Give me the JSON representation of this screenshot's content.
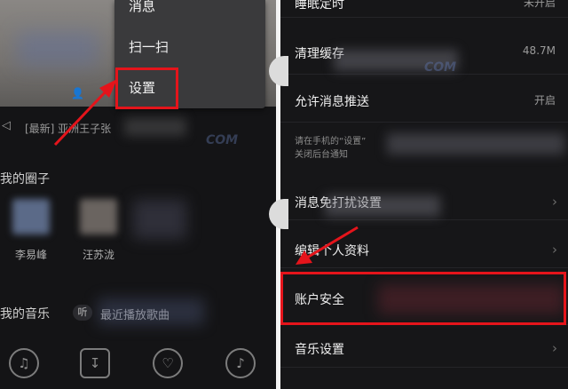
{
  "left": {
    "popup_menu": {
      "messages": "消息",
      "scan": "扫一扫",
      "settings": "设置"
    },
    "notice": {
      "text": "[最新] 亚洲王子张"
    },
    "watermark": "COM",
    "my_circle": {
      "title": "我的圈子",
      "friends": [
        {
          "name": "李易峰"
        },
        {
          "name": "汪苏泷"
        }
      ]
    },
    "my_music": {
      "title": "我的音乐",
      "badge": "听",
      "text": "最近播放歌曲"
    },
    "bottom_icons": [
      "music-note-person-icon",
      "download-icon",
      "heart-icon",
      "music-file-icon"
    ]
  },
  "right": {
    "rows": {
      "sleep_timer": {
        "label": "睡眠定时",
        "value": "未开启"
      },
      "clear_cache": {
        "label": "清理缓存",
        "value": "48.7M"
      },
      "push": {
        "label": "允许消息推送",
        "value": "开启"
      },
      "push_desc_line1": "请在手机的“设置”",
      "push_desc_line2": "关闭后台通知",
      "dnd": {
        "label": "消息免打扰设置"
      },
      "profile": {
        "label": "编辑个人资料"
      },
      "account": {
        "label": "账户安全"
      },
      "music_settings": {
        "label": "音乐设置"
      }
    },
    "watermark": "COM"
  },
  "colors": {
    "highlight": "#e5141b",
    "background": "#141416",
    "popup": "#3a3a3c"
  }
}
